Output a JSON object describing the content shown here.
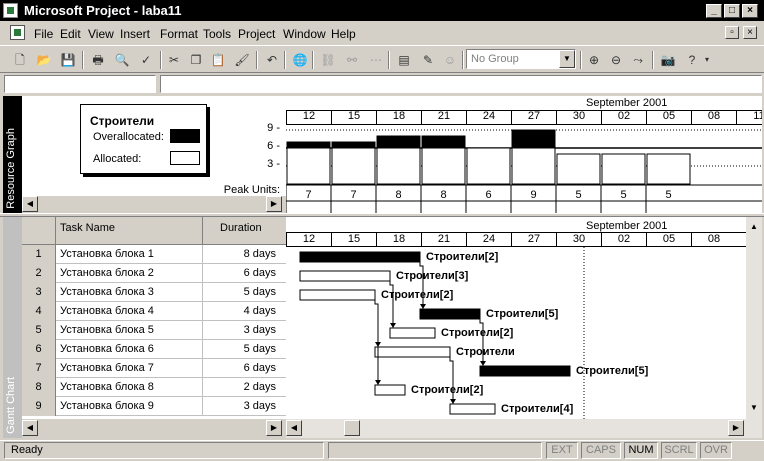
{
  "window": {
    "title": "Microsoft Project - laba11",
    "min": "_",
    "max": "□",
    "close": "×"
  },
  "menu": [
    "File",
    "Edit",
    "View",
    "Insert",
    "Format",
    "Tools",
    "Project",
    "Window",
    "Help"
  ],
  "toolbar": {
    "group_placeholder": "No Group"
  },
  "resource_graph": {
    "view_label": "Resource Graph",
    "resource_name": "Строители",
    "legend_overallocated": "Overallocated:",
    "legend_allocated": "Allocated:",
    "timescale_month": "September 2001",
    "timescale_days": [
      "12",
      "15",
      "18",
      "21",
      "24",
      "27",
      "30",
      "02",
      "05",
      "08",
      "11"
    ],
    "y_ticks": [
      "9 -",
      "6 -",
      "3 -"
    ],
    "peak_label": "Peak Units:",
    "peak_units": [
      "7",
      "7",
      "8",
      "8",
      "6",
      "9",
      "5",
      "5",
      "5"
    ],
    "max_units": 6
  },
  "gantt": {
    "view_label": "Gantt Chart",
    "col_task": "Task Name",
    "col_duration": "Duration",
    "timescale_month": "September 2001",
    "timescale_days": [
      "12",
      "15",
      "18",
      "21",
      "24",
      "27",
      "30",
      "02",
      "05",
      "08"
    ],
    "tasks": [
      {
        "id": "1",
        "name": "Установка блока 1",
        "duration": "8 days",
        "label": "Строители[2]",
        "critical": true
      },
      {
        "id": "2",
        "name": "Установка блока 2",
        "duration": "6 days",
        "label": "Строители[3]",
        "critical": false
      },
      {
        "id": "3",
        "name": "Установка блока 3",
        "duration": "5 days",
        "label": "Строители[2]",
        "critical": false
      },
      {
        "id": "4",
        "name": "Установка блока 4",
        "duration": "4 days",
        "label": "Строители[5]",
        "critical": true
      },
      {
        "id": "5",
        "name": "Установка блока 5",
        "duration": "3 days",
        "label": "Строители[2]",
        "critical": false
      },
      {
        "id": "6",
        "name": "Установка блока 6",
        "duration": "5 days",
        "label": "Строители",
        "critical": false
      },
      {
        "id": "7",
        "name": "Установка блока 7",
        "duration": "6 days",
        "label": "Строители[5]",
        "critical": true
      },
      {
        "id": "8",
        "name": "Установка блока 8",
        "duration": "2 days",
        "label": "Строители[2]",
        "critical": false
      },
      {
        "id": "9",
        "name": "Установка блока 9",
        "duration": "3 days",
        "label": "Строители[4]",
        "critical": false
      }
    ]
  },
  "status": {
    "ready": "Ready",
    "ext": "EXT",
    "caps": "CAPS",
    "num": "NUM",
    "scrl": "SCRL",
    "ovr": "OVR"
  }
}
